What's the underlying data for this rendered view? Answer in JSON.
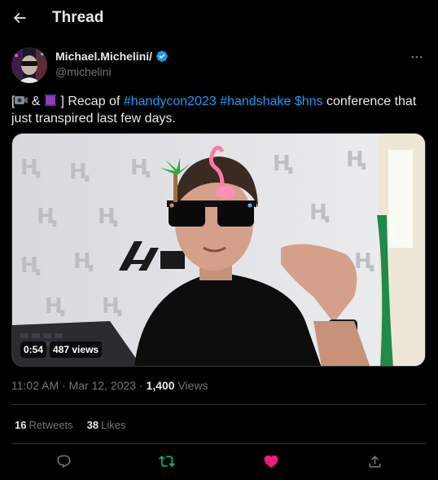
{
  "header": {
    "title": "Thread",
    "back_icon": "arrow-left-icon"
  },
  "author": {
    "display_name": "Michael.Michelini/",
    "handle": "@michelini",
    "verified": true,
    "verified_color": "#1d9bf0"
  },
  "tweet": {
    "text_parts": {
      "open_bracket": "[",
      "emoji1": "camera-emoji",
      "amp": " & ",
      "emoji2": "scroll-emoji",
      "recap": " ] Recap of ",
      "tag1": "#handycon2023",
      "space1": " ",
      "tag2": "#handshake",
      "space2": " ",
      "cashtag": "$hns",
      "rest": " conference that just transpired last few days."
    },
    "link_color": "#1d9bf0"
  },
  "media": {
    "type": "video",
    "duration": "0:54",
    "views_badge": "487 views"
  },
  "meta": {
    "time": "11:02 AM",
    "separator1": " · ",
    "date": "Mar 12, 2023",
    "separator2": " · ",
    "views_count": "1,400",
    "views_label": " Views"
  },
  "stats": {
    "retweets_count": "16",
    "retweets_label": "Retweets",
    "likes_count": "38",
    "likes_label": "Likes"
  },
  "actions": {
    "reply_icon": "reply-icon",
    "retweet_icon": "retweet-icon",
    "like_icon": "heart-icon",
    "share_icon": "share-icon",
    "retweet_color": "#00ba7c",
    "like_color": "#f91880"
  }
}
